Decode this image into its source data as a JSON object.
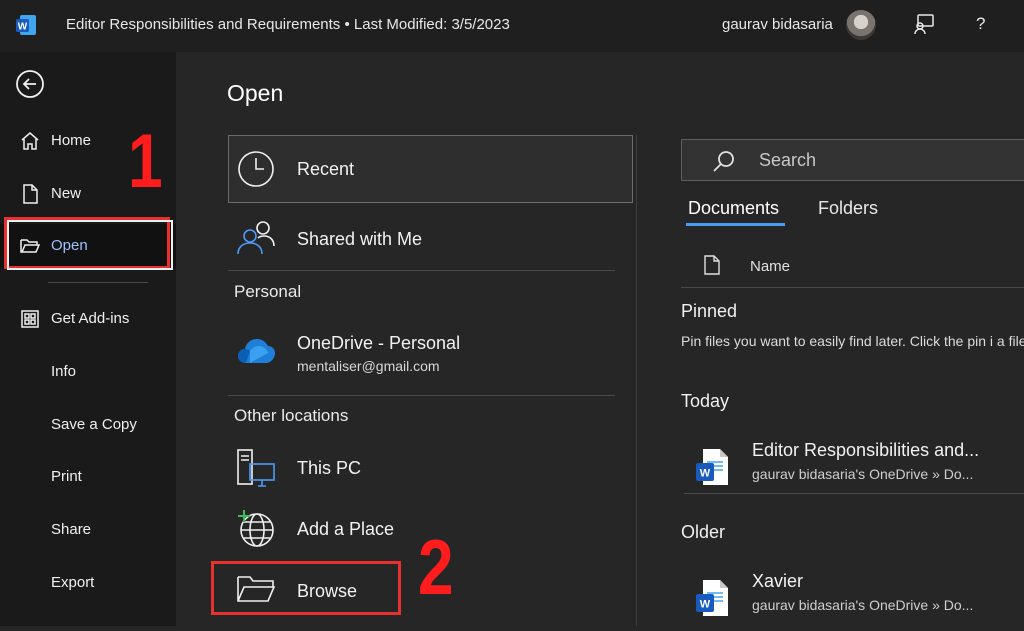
{
  "titlebar": {
    "app_icon_letter": "W",
    "doc_title": "Editor Responsibilities and Requirements  •  Last Modified: 3/5/2023",
    "user_name": "gaurav bidasaria",
    "help_label": "?"
  },
  "nav": {
    "items": [
      {
        "label": "Home",
        "icon": "home-icon"
      },
      {
        "label": "New",
        "icon": "new-document-icon"
      },
      {
        "label": "Open",
        "icon": "folder-open-icon",
        "selected": true
      },
      {
        "label": "Get Add-ins",
        "icon": "add-ins-icon"
      },
      {
        "label": "Info"
      },
      {
        "label": "Save a Copy"
      },
      {
        "label": "Print"
      },
      {
        "label": "Share"
      },
      {
        "label": "Export"
      }
    ]
  },
  "annotations": {
    "step1": "1",
    "step2": "2",
    "color": "#ff1c1c"
  },
  "open": {
    "title": "Open",
    "recent_label": "Recent",
    "shared_label": "Shared with Me",
    "personal_heading": "Personal",
    "onedrive_label": "OneDrive - Personal",
    "onedrive_email": "mentaliser@gmail.com",
    "other_heading": "Other locations",
    "this_pc_label": "This PC",
    "add_place_label": "Add a Place",
    "browse_label": "Browse"
  },
  "files": {
    "search_placeholder": "Search",
    "tabs": [
      "Documents",
      "Folders"
    ],
    "name_header": "Name",
    "pinned_heading": "Pinned",
    "pinned_text": "Pin files you want to easily find later. Click the pin i a file.",
    "today_heading": "Today",
    "older_heading": "Older",
    "today_files": [
      {
        "name": "Editor Responsibilities and...",
        "location": "gaurav bidasaria's OneDrive » Do..."
      }
    ],
    "older_files": [
      {
        "name": "Xavier",
        "location": "gaurav bidasaria's OneDrive » Do..."
      }
    ]
  },
  "colors": {
    "accent": "#4b9cf5",
    "highlight": "#e8312f",
    "word_blue": "#185abd"
  }
}
